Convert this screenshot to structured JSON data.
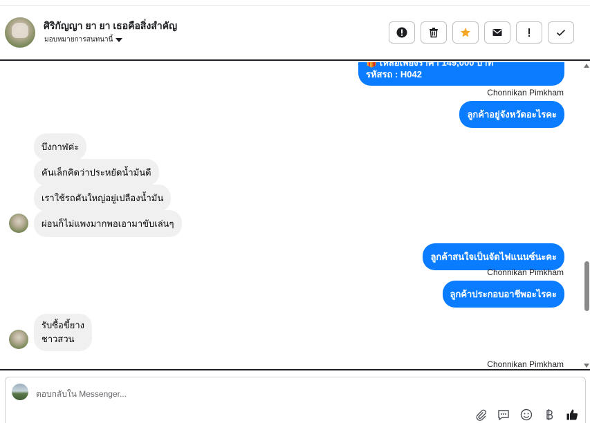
{
  "header": {
    "contact_name": "ศิริกัญญา ยา ยา เธอคือสิ่งสำคัญ",
    "assign_label": "มอบหมายการสนทนานี้"
  },
  "actions": [
    {
      "icon": "alert-circle-icon"
    },
    {
      "icon": "trash-icon"
    },
    {
      "icon": "star-icon",
      "color": "#f5a623"
    },
    {
      "icon": "envelope-icon"
    },
    {
      "icon": "exclamation-icon"
    },
    {
      "icon": "check-icon"
    }
  ],
  "messages": {
    "out_partial_line1": "🎁 เหลือเพียงราคา 149,000 บาท",
    "out_partial_line2": "รหัสรถ : H042",
    "sender_1": "Chonnikan Pimkham",
    "out_1": "ลูกค้าอยู่จังหวัดอะไรคะ",
    "in_1": "บึงกาฬค่ะ",
    "in_2": "คันเล็กคิดว่าประหยัดน้ำมันดี",
    "in_3": "เราใช้รถคันใหญ่อยู่เปลืองน้ำมัน",
    "in_4": "ผ่อนก็ไม่แพงมากพอเอามาขับเล่นๆ",
    "out_2": "ลูกค้าสนใจเป็นจัดไฟแนนซ์นะคะ",
    "sender_2": "Chonnikan Pimkham",
    "out_3": "ลูกค้าประกอบอาชีพอะไรคะ",
    "in_5_line1": "รับซื้อขี้ยาง",
    "in_5_line2": "ชาวสวน",
    "sender_3": "Chonnikan Pimkham"
  },
  "composer": {
    "placeholder": "ตอบกลับใน Messenger..."
  },
  "colors": {
    "outgoing_bubble": "#0a7cff",
    "incoming_bubble": "#f0f0f0"
  }
}
